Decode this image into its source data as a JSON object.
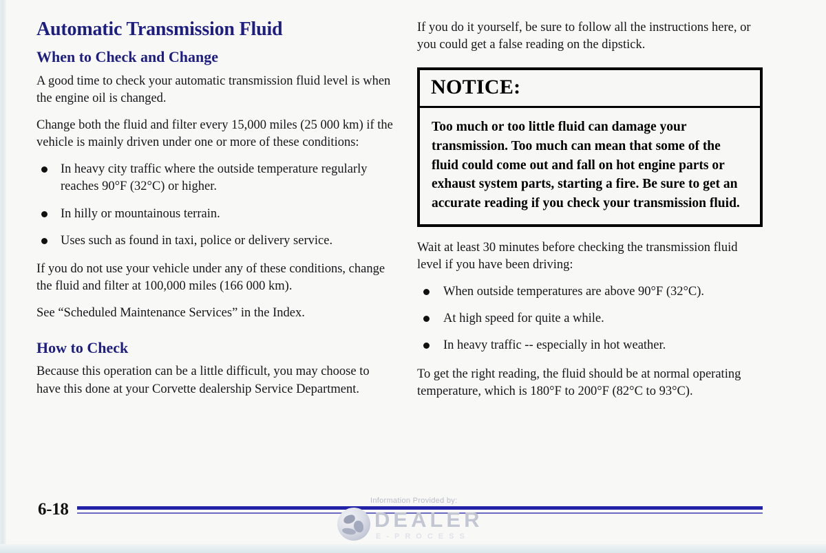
{
  "page": {
    "number": "6-18",
    "heading_color": "#1e1e82",
    "rule_color": "#2222a8"
  },
  "left_column": {
    "title": "Automatic Transmission Fluid",
    "section_when": {
      "heading": "When to Check and Change",
      "paragraphs": [
        "A good time to check your automatic transmission fluid level is when the engine oil is changed.",
        "Change both the fluid and filter every 15,000 miles (25 000 km) if the vehicle is mainly driven under one or more of these conditions:"
      ],
      "bullets": [
        "In heavy city traffic where the outside temperature regularly reaches 90°F (32°C) or higher.",
        "In hilly or mountainous terrain.",
        "Uses such as found in taxi, police or delivery service."
      ],
      "paragraphs_after": [
        "If you do not use your vehicle under any of these conditions, change the fluid and filter at 100,000 miles (166 000 km).",
        "See “Scheduled Maintenance Services” in the Index."
      ]
    },
    "section_how": {
      "heading": "How to Check",
      "paragraphs": [
        "Because this operation can be a little difficult, you may choose to have this done at your Corvette dealership Service Department."
      ]
    }
  },
  "right_column": {
    "intro": "If you do it yourself, be sure to follow all the instructions here, or you could get a false reading on the dipstick.",
    "notice": {
      "label": "NOTICE:",
      "text": "Too much or too little fluid can damage your transmission. Too much can mean that some of the fluid could come out and fall on hot engine parts or exhaust system parts, starting a fire. Be sure to get an accurate reading if you check your transmission fluid."
    },
    "wait_paragraph": "Wait at least 30 minutes before checking the transmission fluid level if you have been driving:",
    "bullets": [
      "When outside temperatures are above 90°F (32°C).",
      "At high speed for quite a while.",
      "In heavy traffic -- especially in hot weather."
    ],
    "closing_paragraph": "To get the right reading, the fluid should be at normal operating temperature, which is 180°F to 200°F (82°C to 93°C)."
  },
  "watermark": {
    "caption": "Information Provided by:",
    "word": "DEALER",
    "sub": "E-PROCESS"
  }
}
